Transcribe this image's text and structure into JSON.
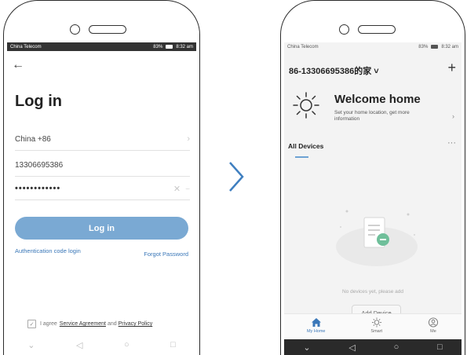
{
  "left_phone": {
    "status": {
      "carrier": "China Telecom",
      "indicators": "83%",
      "time": "8:32 am"
    },
    "title": "Log in",
    "country_field": "China +86",
    "phone_field": "13306695386",
    "password_field": "••••••••••••",
    "login_button": "Log in",
    "auth_code_link": "Authentication code login",
    "forgot_link": "Forgot Password",
    "agree": {
      "prefix": "I agree",
      "service": "Service Agreement",
      "and": "and",
      "privacy": "Privacy Policy"
    }
  },
  "right_phone": {
    "status": {
      "carrier": "China Telecom",
      "indicators": "83%",
      "time": "8:32 am"
    },
    "home_title": "86-13306695386的家 ˅",
    "add_icon": "plus-icon",
    "welcome_title": "Welcome home",
    "welcome_subtitle": "Set your home location, get more information",
    "all_devices": "All Devices",
    "empty_text": "No devices yet, please add",
    "add_device_button": "Add Device",
    "tabs": [
      {
        "label": "My Home",
        "icon": "home-icon",
        "active": true
      },
      {
        "label": "Smart",
        "icon": "sun-icon",
        "active": false
      },
      {
        "label": "Me",
        "icon": "profile-icon",
        "active": false
      }
    ]
  },
  "colors": {
    "accent": "#7aa9d3",
    "link": "#3a77b8"
  }
}
